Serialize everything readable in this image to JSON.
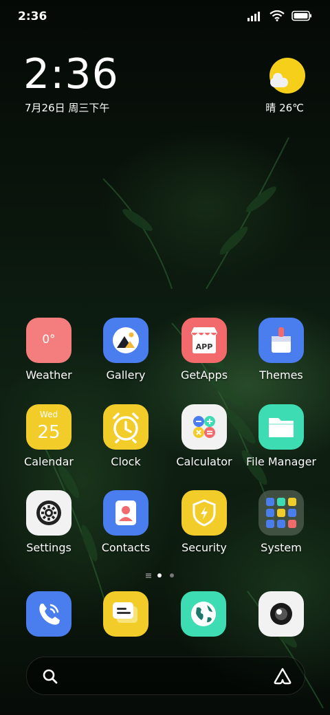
{
  "status_bar": {
    "time": "2:36"
  },
  "clock": {
    "time": "2:36",
    "date": "7月26日 周三下午"
  },
  "weather": {
    "text": "晴 26℃"
  },
  "apps": [
    {
      "label": "Weather",
      "icon_text": "0°",
      "color": "#f47d7e"
    },
    {
      "label": "Gallery",
      "color": "#4a7ded"
    },
    {
      "label": "GetApps",
      "icon_text": "APP",
      "color": "#f26a6b"
    },
    {
      "label": "Themes",
      "color": "#4a7ded"
    },
    {
      "label": "Calendar",
      "icon_day": "Wed",
      "icon_date": "25",
      "color": "#f2cd2a"
    },
    {
      "label": "Clock",
      "color": "#f2cd2a"
    },
    {
      "label": "Calculator",
      "color": "#f2f2f2"
    },
    {
      "label": "File Manager",
      "color": "#3ddcb3"
    },
    {
      "label": "Settings",
      "color": "#f2f2f2"
    },
    {
      "label": "Contacts",
      "color": "#4a7ded"
    },
    {
      "label": "Security",
      "color": "#f2cd2a"
    },
    {
      "label": "System",
      "color": "#3c4a3c"
    }
  ],
  "dock": [
    {
      "name": "Phone",
      "color": "#4a7ded"
    },
    {
      "name": "Messages",
      "color": "#f2cd2a"
    },
    {
      "name": "Browser",
      "color": "#3ddcb3"
    },
    {
      "name": "Camera",
      "color": "#f2f2f2"
    }
  ],
  "page_indicator": {
    "pages": 2,
    "current": 1
  },
  "icons": [
    "signal-icon",
    "wifi-icon",
    "battery-icon",
    "search-icon",
    "assistant-icon"
  ]
}
